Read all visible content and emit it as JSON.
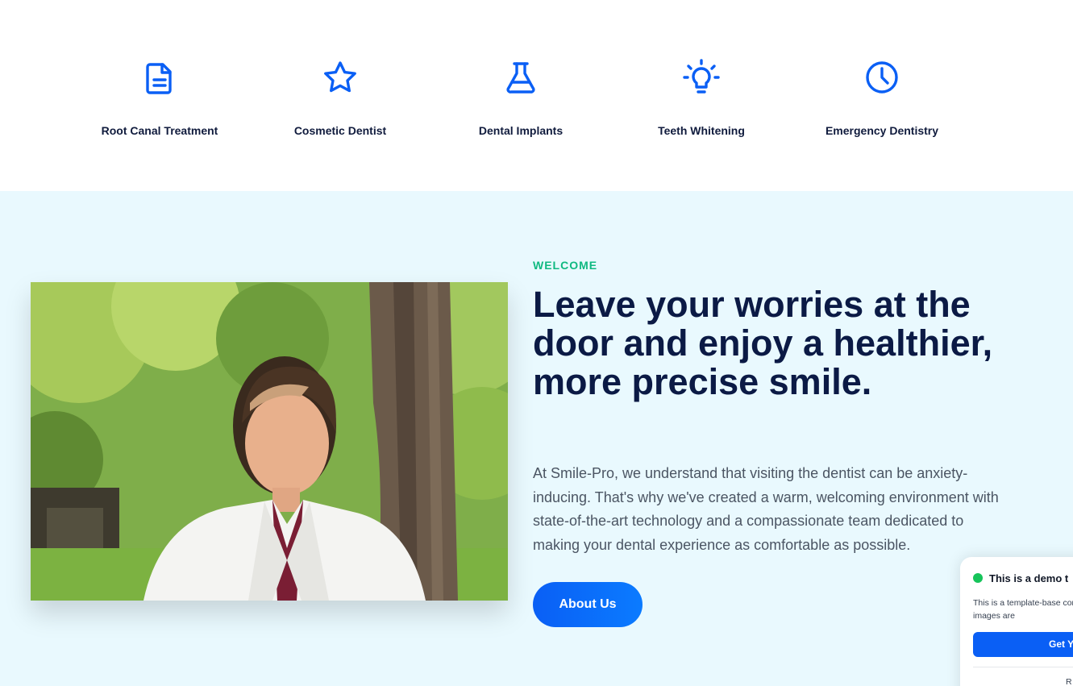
{
  "services": {
    "items": [
      {
        "label": "Root Canal Treatment",
        "icon": "document-icon"
      },
      {
        "label": "Cosmetic Dentist",
        "icon": "star-icon"
      },
      {
        "label": "Dental Implants",
        "icon": "flask-icon"
      },
      {
        "label": "Teeth Whitening",
        "icon": "lightbulb-icon"
      },
      {
        "label": "Emergency Dentistry",
        "icon": "clock-icon"
      }
    ],
    "icon_color": "#0a5ff5"
  },
  "welcome": {
    "eyebrow": "WELCOME",
    "headline": "Leave your worries at the door and enjoy a healthier, more precise smile.",
    "intro": "At Smile-Pro, we understand that visiting the dentist can be anxiety-inducing. That's why we've created a warm, welcoming environment with state-of-the-art technology and a compassionate team dedicated to making your dental experience as comfortable as possible.",
    "button_label": "About Us",
    "accent_color": "#10b981",
    "background_color": "#e9f9fe"
  },
  "demo_notice": {
    "title": "This is a demo t",
    "text": "This is a template-base content and images are",
    "button_label": "Get Y",
    "link_label": "R",
    "status_color": "#16c45a"
  }
}
